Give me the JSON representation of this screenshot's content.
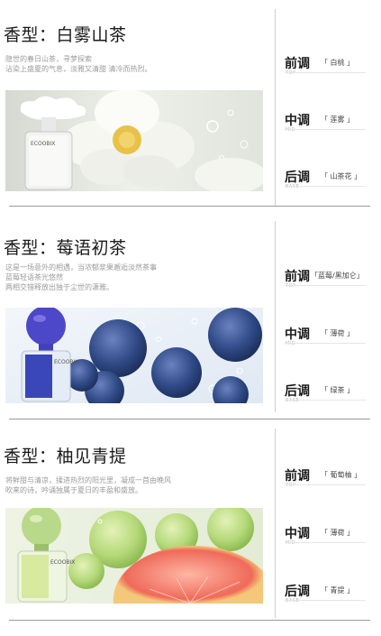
{
  "sections": [
    {
      "title": "香型：白雾山茶",
      "desc": [
        "隐世的春日山茶，寻梦探索",
        "沾染上盛夏的气息，淡雅又清甜 清冷而热烈。"
      ],
      "brand": "ECOOBIX",
      "notes": [
        {
          "label": "前调",
          "value": "「   白桃   」",
          "sub": "TOP"
        },
        {
          "label": "中调",
          "value": "「   莲雾   」",
          "sub": "MID"
        },
        {
          "label": "后调",
          "value": "「 山茶花 」",
          "sub": "BASE"
        }
      ]
    },
    {
      "title": "香型：莓语初茶",
      "desc": [
        "这是一场意外的相遇，当浓郁浆果邂逅淡然茶事",
        "蓝莓轻语茶光悠然",
        "两相交错释放出独于尘世的潇雅。"
      ],
      "brand": "ECOOBIX",
      "notes": [
        {
          "label": "前调",
          "value": "「蓝莓/黑加仑」",
          "sub": "TOP"
        },
        {
          "label": "中调",
          "value": "「   薄荷   」",
          "sub": "MID"
        },
        {
          "label": "后调",
          "value": "「   绿茶   」",
          "sub": "BASE"
        }
      ]
    },
    {
      "title": "香型：柚见青提",
      "desc": [
        "将鲜甜与清凉，揉进热烈的阳光里，凝成一首由晚风",
        "吹来的诗，吟诵独属于夏日的丰盈和盛放。"
      ],
      "brand": "ECOOBIX",
      "notes": [
        {
          "label": "前调",
          "value": "「 葡萄柚 」",
          "sub": "TOP"
        },
        {
          "label": "中调",
          "value": "「   薄荷   」",
          "sub": "MID"
        },
        {
          "label": "后调",
          "value": "「   青提   」",
          "sub": "BASE"
        }
      ]
    }
  ],
  "colors": {
    "camellia_bg": "#e9ebe6",
    "blueberry": "#2f4a86",
    "grape_green": "#b5d97a",
    "grapefruit": "#ef6a5a"
  }
}
